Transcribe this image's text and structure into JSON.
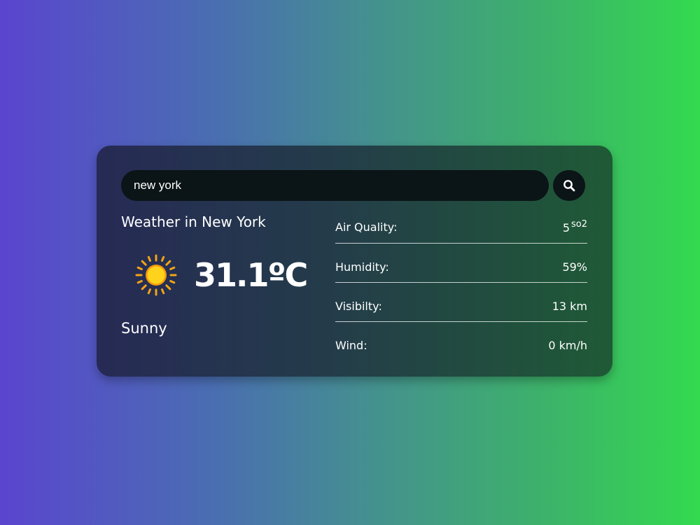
{
  "search": {
    "value": "new york",
    "icon": "search-icon"
  },
  "weather": {
    "title": "Weather in New York",
    "temperature": "31.1ºC",
    "condition": "Sunny",
    "icon": "sun-icon"
  },
  "stats": {
    "air_quality": {
      "label": "Air Quality:",
      "value": "5",
      "unit": "so2"
    },
    "humidity": {
      "label": "Humidity:",
      "value": "59%"
    },
    "visibility": {
      "label": "Visibilty:",
      "value": "13 km"
    },
    "wind": {
      "label": "Wind:",
      "value": "0 km/h"
    }
  },
  "colors": {
    "sun": "#f5c518",
    "sun_rays": "#f2a516",
    "input_bg": "#0b1416"
  }
}
